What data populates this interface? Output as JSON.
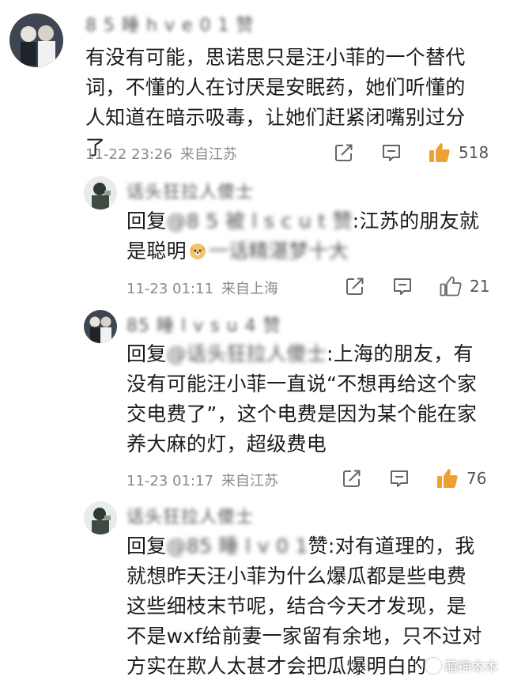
{
  "colors": {
    "like_active": "#f0a030",
    "meta_text": "#8a8a8a",
    "body_text": "#1b1b1b"
  },
  "comments": [
    {
      "username": "8 5 睡 h v e 0 1 赞",
      "segments": [
        {
          "text": "有没有可能，思诺思只是汪小菲的一个替代词，不懂的人在讨厌是安眠药，她们听懂的人知道在暗示吸毒，让她们赶紧闭嘴别过分了"
        }
      ],
      "time": "11-22 23:26",
      "location": "来自江苏",
      "likes": "518",
      "liked": true
    },
    {
      "username": "话头狂拉人傻士",
      "reply_prefix": "回复",
      "blur_mention": "@8 5 被 l s c u t 赞",
      "segments_after": ":江苏的朋友就是聪明",
      "emoji": "doge-emoji",
      "blur_tail": "一话精湛梦十大",
      "time": "11-23 01:11",
      "location": "来自上海",
      "likes": "21",
      "liked": false
    },
    {
      "username": "85 睡 l v s u 4 赞",
      "reply_prefix": "回复",
      "blur_mention": "@话头狂拉人傻士",
      "segments_after": ":上海的朋友，有没有可能汪小菲一直说“不想再给这个家交电费了”，这个电费是因为某个能在家养大麻的灯，超级费电",
      "time": "11-23 01:17",
      "location": "来自江苏",
      "likes": "76",
      "liked": true
    },
    {
      "username": "话头狂拉人傻士",
      "reply_prefix": "回复",
      "blur_mention": "@85 睡 l v 0 1",
      "segments_after": "赞:对有道理的，我就想昨天汪小菲为什么爆瓜都是些电费这些细枝末节呢，结合今天才发现，是不是wxf给前妻一家留有余地，只不过对方实在欺人太甚才会把瓜爆明白的"
    }
  ],
  "watermark": "萌神木木"
}
